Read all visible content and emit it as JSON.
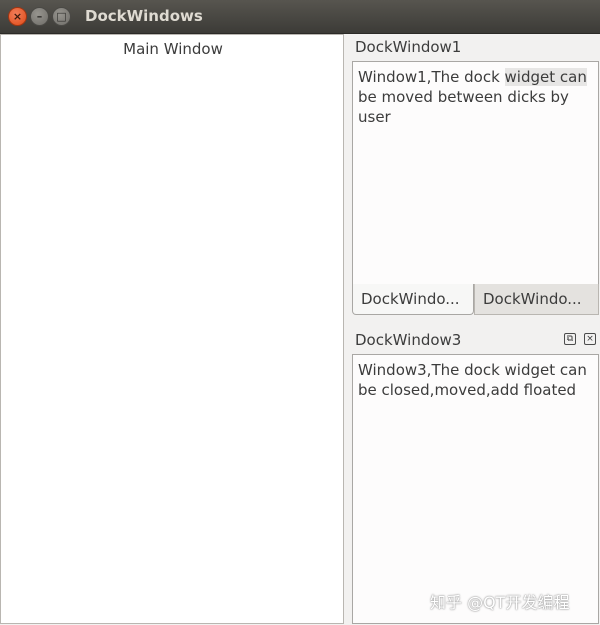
{
  "window": {
    "title": "DockWindows",
    "controls": {
      "close": "×",
      "minimize": "–",
      "maximize": "□"
    }
  },
  "central": {
    "label": "Main Window"
  },
  "docks": {
    "dock1": {
      "title": "DockWindow1",
      "text_before": "Window1,The dock ",
      "text_highlight": "widget can",
      "text_after": " be moved between dicks by user"
    },
    "tabs": [
      "DockWindo...",
      "DockWindo..."
    ],
    "dock3": {
      "title": "DockWindow3",
      "text": "Window3,The dock widget can be closed,moved,add floated",
      "float_glyph": "⧉",
      "close_glyph": "×"
    }
  },
  "watermark": "知乎 @QT开发编程"
}
